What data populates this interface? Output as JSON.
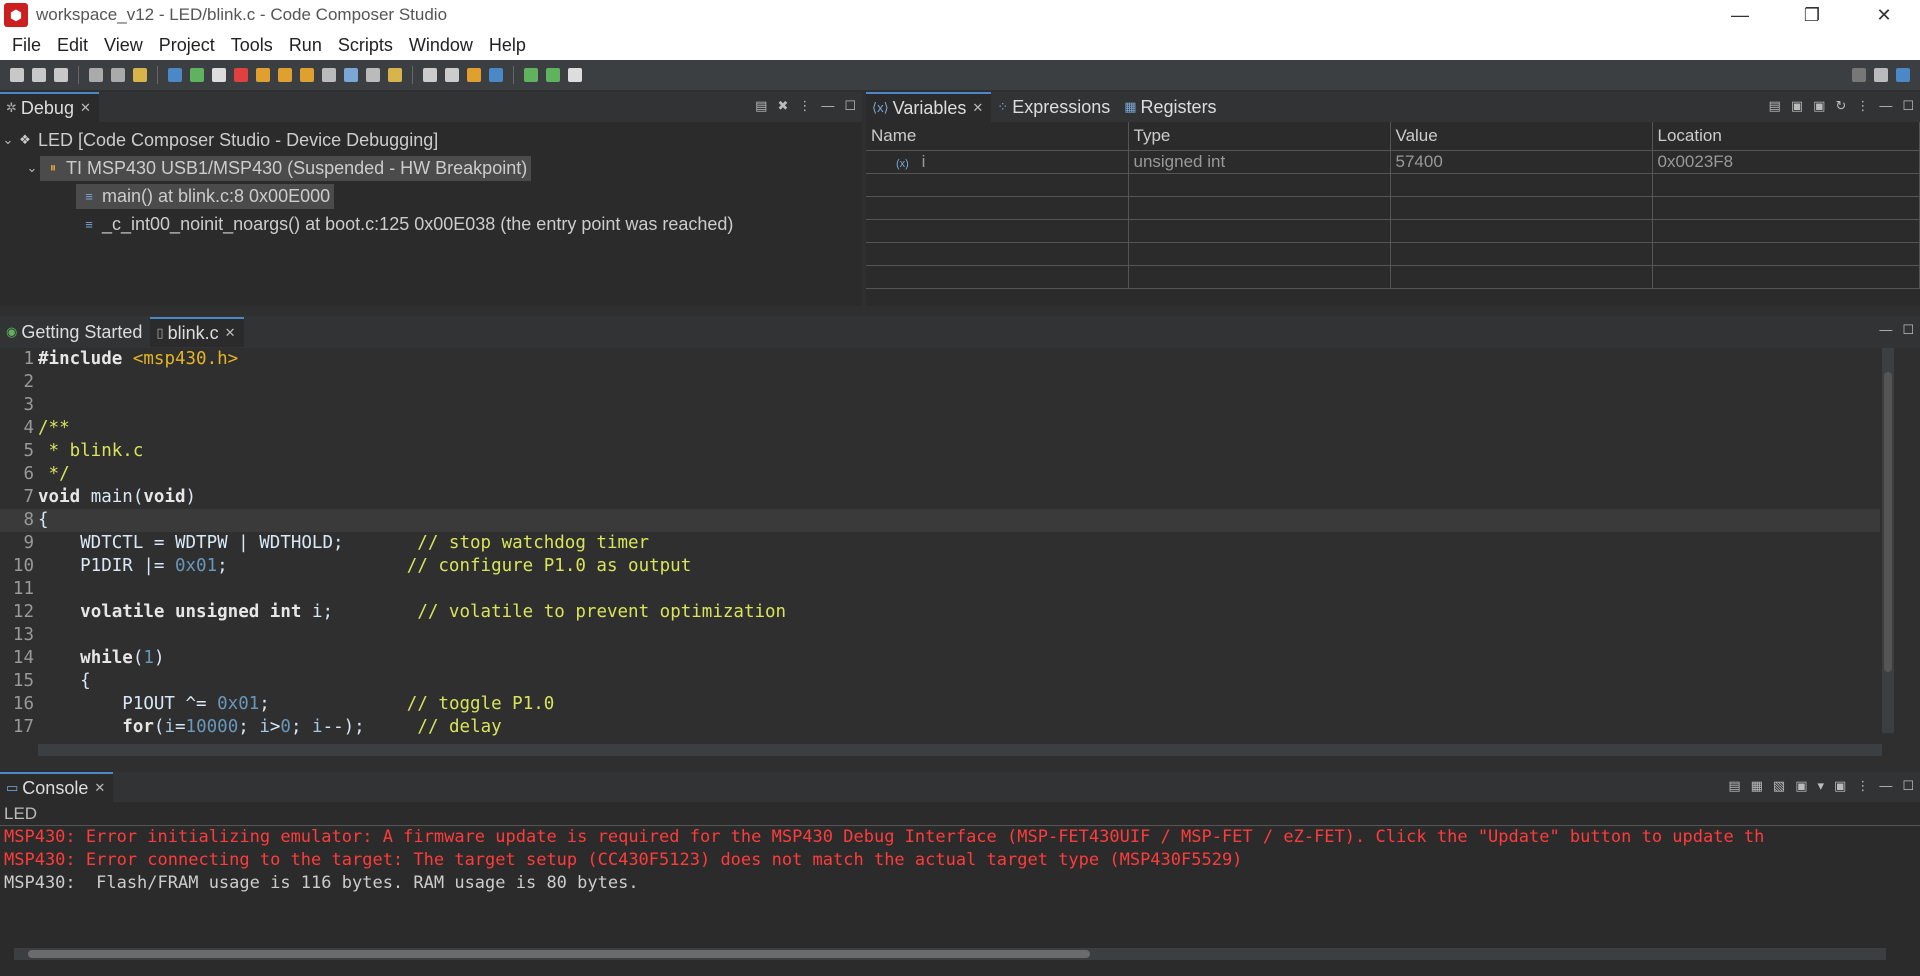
{
  "window": {
    "title": "workspace_v12 - LED/blink.c - Code Composer Studio",
    "minimize": "—",
    "restore": "❐",
    "close": "✕"
  },
  "menubar": [
    "File",
    "Edit",
    "View",
    "Project",
    "Tools",
    "Run",
    "Scripts",
    "Window",
    "Help"
  ],
  "debug": {
    "tab_label": "Debug",
    "root": "LED [Code Composer Studio - Device Debugging]",
    "target": "TI MSP430 USB1/MSP430 (Suspended - HW Breakpoint)",
    "frames": [
      "main() at blink.c:8 0x00E000",
      "_c_int00_noinit_noargs() at boot.c:125 0x00E038  (the entry point was reached)"
    ]
  },
  "variables": {
    "tabs": [
      "Variables",
      "Expressions",
      "Registers"
    ],
    "columns": [
      "Name",
      "Type",
      "Value",
      "Location"
    ],
    "rows": [
      {
        "name": "i",
        "type": "unsigned int",
        "value": "57400",
        "location": "0x0023F8"
      }
    ]
  },
  "editor": {
    "tabs": [
      "Getting Started",
      "blink.c"
    ],
    "current_line": 8
  },
  "console": {
    "tab_label": "Console",
    "context": "LED",
    "lines": [
      {
        "kind": "err",
        "text": "MSP430: Error initializing emulator: A firmware update is required for the MSP430 Debug Interface (MSP-FET430UIF / MSP-FET / eZ-FET). Click the \"Update\" button to update th"
      },
      {
        "kind": "err",
        "text": "MSP430: Error connecting to the target: The target setup (CC430F5123) does not match the actual target type (MSP430F5529)"
      },
      {
        "kind": "info",
        "text": "MSP430:  Flash/FRAM usage is 116 bytes. RAM usage is 80 bytes."
      }
    ]
  }
}
